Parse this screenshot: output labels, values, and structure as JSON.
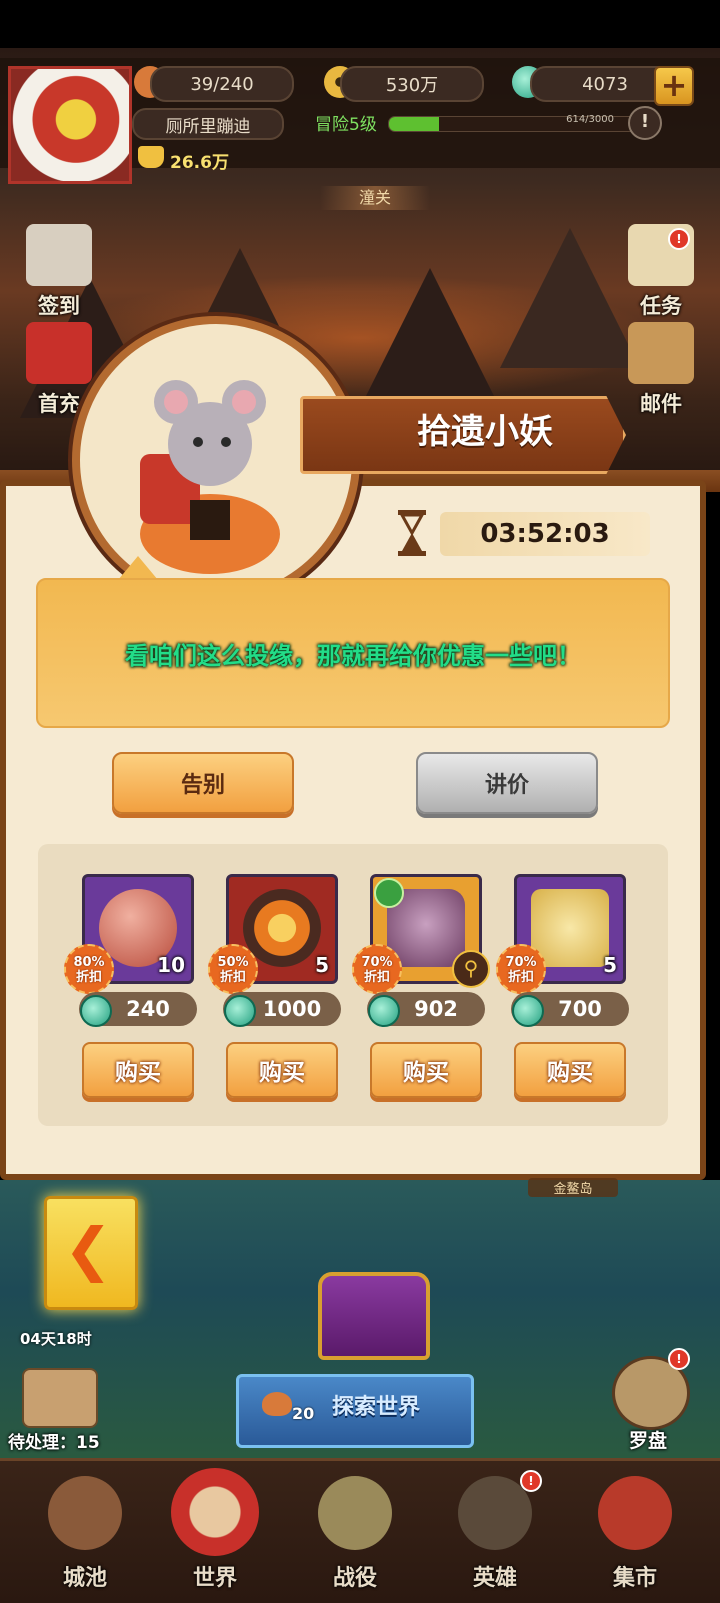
{
  "hud": {
    "stamina": "39/240",
    "coins": "530万",
    "jade": "4073",
    "add": "+",
    "player_name": "厕所里蹦迪",
    "adventure_level": "冒险5级",
    "xp_text": "614/3000",
    "xp_fraction": 0.2047,
    "info": "!",
    "power": "26.6万",
    "stage": "潼关"
  },
  "side_buttons": {
    "checkin": "签到",
    "first_charge": "首充",
    "tasks": "任务",
    "mail": "邮件"
  },
  "npc": {
    "name": "拾遗小妖",
    "timer": "03:52:03",
    "dialogue": "看咱们这么投缘，那就再给你优惠一些吧！"
  },
  "actions": {
    "farewell": "告别",
    "bargain": "讲价"
  },
  "shop": {
    "items": [
      {
        "icon": "sword-token-icon",
        "qty": "10",
        "discount_pct": "80%",
        "discount_word": "折扣",
        "price": "240",
        "buy": "购买",
        "bg": "#6a3a9a"
      },
      {
        "icon": "fire-emblem-icon",
        "qty": "5",
        "discount_pct": "50%",
        "discount_word": "折扣",
        "price": "1000",
        "buy": "购买",
        "bg": "#a02a22"
      },
      {
        "icon": "armor-icon",
        "qty": "",
        "discount_pct": "70%",
        "discount_word": "折扣",
        "price": "902",
        "buy": "购买",
        "bg": "#e8a030"
      },
      {
        "icon": "pagoda-icon",
        "qty": "5",
        "discount_pct": "70%",
        "discount_word": "折扣",
        "price": "700",
        "buy": "购买",
        "bg": "#6a3a9a"
      }
    ]
  },
  "world": {
    "days": "04天18时",
    "pending": "待处理：15",
    "explore_cost": "20",
    "explore": "探索世界",
    "compass": "罗盘",
    "island": "金鳌岛"
  },
  "nav": {
    "city": "城池",
    "world": "世界",
    "campaign": "战役",
    "heroes": "英雄",
    "market": "集市"
  }
}
